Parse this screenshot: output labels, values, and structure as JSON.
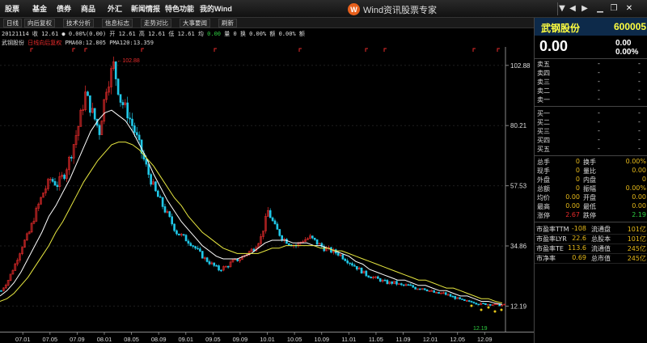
{
  "menu": [
    "股票",
    "基金",
    "债券",
    "商品",
    "外汇",
    "新闻情报",
    "特色功能",
    "我的Wind"
  ],
  "brand": {
    "logo": "W",
    "title": "Wind资讯股票专家"
  },
  "window_controls": [
    "chevron-down",
    "arrow-left",
    "arrow-right",
    "minimize",
    "restore",
    "close"
  ],
  "toolbar": [
    "日线",
    "向后复权",
    "技术分析",
    "信息标志",
    "走势对比",
    "大事要闻",
    "刷新"
  ],
  "info1": {
    "text": "20121114 收 12.61 ● 0.00%(0.00) 开 12.61 高 12.61 低 12.61 均",
    "green": "0.00",
    "rest": "量 0 换 0.00% 额 0.00% 额"
  },
  "info2": {
    "name": "武钢股份",
    "tag": "日线向后复权",
    "ma": "PMA60:12.805 PMA120:13.359"
  },
  "chart_data": {
    "type": "line",
    "title": "",
    "series": [
      {
        "name": "K线",
        "values": [
          18,
          22,
          28,
          35,
          40,
          48,
          55,
          60,
          58,
          62,
          70,
          80,
          92,
          85,
          78,
          95,
          102.88,
          90,
          85,
          78,
          70,
          62,
          55,
          50,
          45,
          40,
          38,
          36,
          33,
          30,
          28,
          26,
          27,
          29,
          30,
          32,
          34,
          38,
          48,
          42,
          38,
          36,
          35,
          37,
          38,
          36,
          34,
          33,
          32,
          30,
          28,
          26,
          24,
          23,
          22,
          21,
          21,
          20,
          20,
          19,
          19,
          18,
          17,
          17,
          16,
          15,
          14,
          14,
          13,
          13,
          12.8,
          12.6,
          12.61
        ]
      },
      {
        "name": "PMA60",
        "values": [
          16,
          18,
          21,
          25,
          30,
          35,
          40,
          46,
          50,
          55,
          60,
          66,
          72,
          78,
          82,
          85,
          86,
          84,
          82,
          78,
          73,
          68,
          62,
          57,
          52,
          48,
          44,
          41,
          38,
          35,
          33,
          31,
          30,
          30,
          30,
          31,
          32,
          34,
          36,
          37,
          37,
          37,
          36,
          36,
          36,
          35,
          35,
          34,
          33,
          32,
          31,
          29,
          28,
          26,
          25,
          24,
          23,
          22,
          22,
          21,
          20,
          20,
          19,
          18,
          18,
          17,
          16,
          16,
          15,
          14,
          14,
          13.3,
          12.805
        ]
      },
      {
        "name": "PMA120",
        "values": [
          14,
          15,
          17,
          20,
          23,
          27,
          31,
          35,
          40,
          44,
          49,
          54,
          59,
          63,
          67,
          70,
          73,
          74,
          74,
          73,
          71,
          68,
          65,
          61,
          57,
          53,
          50,
          46,
          43,
          40,
          38,
          36,
          34,
          33,
          32,
          32,
          32,
          32,
          33,
          34,
          34,
          35,
          35,
          35,
          35,
          35,
          34,
          34,
          33,
          33,
          32,
          31,
          30,
          29,
          28,
          27,
          26,
          25,
          24,
          23,
          22,
          22,
          21,
          20,
          19,
          19,
          18,
          17,
          16,
          15,
          15,
          14,
          13.359
        ]
      }
    ],
    "yticks": [
      102.88,
      80.21,
      57.53,
      34.86,
      12.19
    ],
    "xticks": [
      "07.01",
      "07.05",
      "07.09",
      "08.01",
      "08.05",
      "08.09",
      "09.01",
      "09.05",
      "09.09",
      "10.01",
      "10.05",
      "10.09",
      "11.01",
      "11.05",
      "11.09",
      "12.01",
      "12.05",
      "12.09"
    ],
    "ylim": [
      5,
      108
    ],
    "annotation_max": "102.88",
    "annotation_min": "12.19",
    "colors": {
      "up": "#e82b2b",
      "down": "#20c8e8",
      "pma60": "#ffffff",
      "pma120": "#e8e840",
      "grid": "#1e1e1e",
      "marker": "#e82b2b",
      "dot": "#e8c81a"
    }
  },
  "quote": {
    "name": "武钢股份",
    "code": "600005",
    "price": "0.00",
    "change": "0.00",
    "pct": "0.00%"
  },
  "orderbook": {
    "asks": [
      {
        "label": "卖五",
        "price": "-",
        "vol": "-"
      },
      {
        "label": "卖四",
        "price": "-",
        "vol": "-"
      },
      {
        "label": "卖三",
        "price": "-",
        "vol": "-"
      },
      {
        "label": "卖二",
        "price": "-",
        "vol": "-"
      },
      {
        "label": "卖一",
        "price": "-",
        "vol": "-"
      }
    ],
    "bids": [
      {
        "label": "买一",
        "price": "-",
        "vol": "-"
      },
      {
        "label": "买二",
        "price": "-",
        "vol": "-"
      },
      {
        "label": "买三",
        "price": "-",
        "vol": "-"
      },
      {
        "label": "买四",
        "price": "-",
        "vol": "-"
      },
      {
        "label": "买五",
        "price": "-",
        "vol": "-"
      }
    ]
  },
  "stats": [
    {
      "l1": "总手",
      "v1": "0",
      "l2": "换手",
      "v2": "0.00%"
    },
    {
      "l1": "现手",
      "v1": "0",
      "l2": "量比",
      "v2": "0.00"
    },
    {
      "l1": "外盘",
      "v1": "0",
      "l2": "内盘",
      "v2": "0"
    },
    {
      "l1": "总额",
      "v1": "0",
      "l2": "振幅",
      "v2": "0.00%"
    },
    {
      "l1": "均价",
      "v1": "0.00",
      "l2": "开盘",
      "v2": "0.00"
    },
    {
      "l1": "最高",
      "v1": "0.00",
      "l2": "最低",
      "v2": "0.00"
    },
    {
      "l1": "涨停",
      "v1": "2.67",
      "l2": "跌停",
      "v2": "2.19"
    }
  ],
  "fundamentals": [
    {
      "l1": "市盈率TTM",
      "v1": "-108",
      "l2": "流通盘",
      "v2": "101亿"
    },
    {
      "l1": "市盈率LYR",
      "v1": "22.6",
      "l2": "总股本",
      "v2": "101亿"
    },
    {
      "l1": "市盈率TE",
      "v1": "113.6",
      "l2": "流通值",
      "v2": "245亿"
    },
    {
      "l1": "市净率",
      "v1": "0.69",
      "l2": "总市值",
      "v2": "245亿"
    }
  ]
}
